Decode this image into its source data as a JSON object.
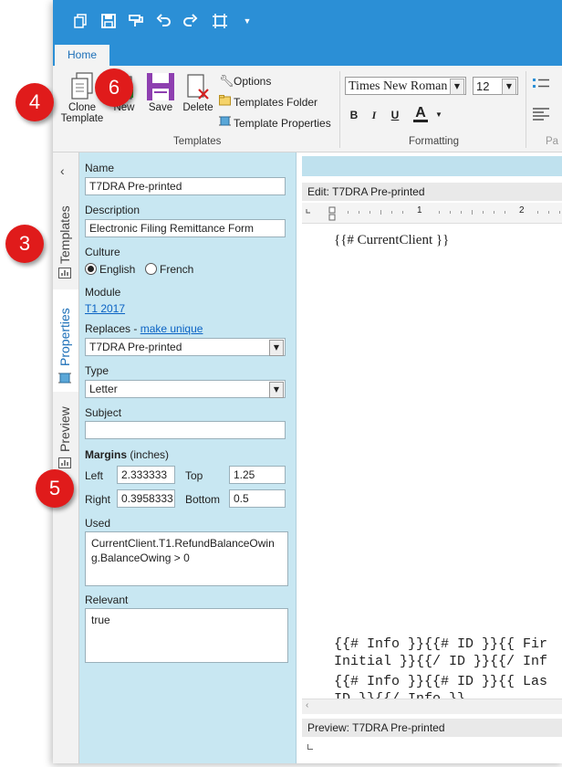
{
  "ribbon": {
    "home_tab": "Home",
    "templates_group": "Templates",
    "formatting_group": "Formatting",
    "partial_group": "Pa",
    "clone_line1": "Clone",
    "clone_line2": "Template",
    "new_label": "New",
    "save_label": "Save",
    "delete_label": "Delete",
    "options_label": "Options",
    "templates_folder_label": "Templates Folder",
    "template_properties_label": "Template Properties",
    "font_name": "Times New Roman",
    "font_size": "12",
    "bold": "B",
    "italic": "I",
    "underline": "U",
    "font_color": "A"
  },
  "side_tabs": {
    "templates": "Templates",
    "properties": "Properties",
    "preview": "Preview"
  },
  "props": {
    "name_label": "Name",
    "name_value": "T7DRA Pre-printed",
    "description_label": "Description",
    "description_value": "Electronic Filing Remittance Form",
    "culture_label": "Culture",
    "culture_english": "English",
    "culture_french": "French",
    "module_label": "Module",
    "module_value": "T1 2017",
    "replaces_label": "Replaces -",
    "make_unique": "make unique",
    "replaces_value": "T7DRA Pre-printed",
    "type_label": "Type",
    "type_value": "Letter",
    "subject_label": "Subject",
    "subject_value": "",
    "margins_label": "Margins",
    "margins_unit": "(inches)",
    "left_label": "Left",
    "left_value": "2.333333",
    "top_label": "Top",
    "top_value": "1.25",
    "right_label": "Right",
    "right_value": "0.3958333",
    "bottom_label": "Bottom",
    "bottom_value": "0.5",
    "used_label": "Used",
    "used_value": "CurrentClient.T1.RefundBalanceOwing.BalanceOwing > 0",
    "relevant_label": "Relevant",
    "relevant_value": "true"
  },
  "editor": {
    "edit_title": "Edit: T7DRA Pre-printed",
    "ruler_1": "1",
    "ruler_2": "2",
    "doc_line": "{{# CurrentClient }}",
    "code_line1": "{{# Info }}{{# ID }}{{ Fir",
    "code_line2": "Initial }}{{/ ID }}{{/ Inf",
    "code_line3": "{{# Info }}{{# ID }}{{ Las",
    "code_line4": "ID }}{{/ Info }}",
    "preview_title": "Preview: T7DRA Pre-printed"
  },
  "callouts": [
    "3",
    "4",
    "5",
    "6"
  ],
  "colors": {
    "accent": "#2b8fd6",
    "panel": "#c8e7f2",
    "callout": "#e01b1b"
  }
}
